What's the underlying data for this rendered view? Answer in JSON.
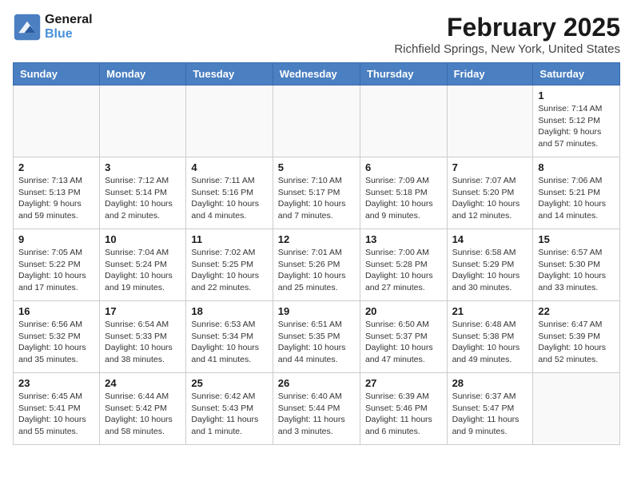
{
  "logo": {
    "line1": "General",
    "line2": "Blue"
  },
  "title": "February 2025",
  "location": "Richfield Springs, New York, United States",
  "days_of_week": [
    "Sunday",
    "Monday",
    "Tuesday",
    "Wednesday",
    "Thursday",
    "Friday",
    "Saturday"
  ],
  "weeks": [
    [
      {
        "day": "",
        "info": ""
      },
      {
        "day": "",
        "info": ""
      },
      {
        "day": "",
        "info": ""
      },
      {
        "day": "",
        "info": ""
      },
      {
        "day": "",
        "info": ""
      },
      {
        "day": "",
        "info": ""
      },
      {
        "day": "1",
        "info": "Sunrise: 7:14 AM\nSunset: 5:12 PM\nDaylight: 9 hours and 57 minutes."
      }
    ],
    [
      {
        "day": "2",
        "info": "Sunrise: 7:13 AM\nSunset: 5:13 PM\nDaylight: 9 hours and 59 minutes."
      },
      {
        "day": "3",
        "info": "Sunrise: 7:12 AM\nSunset: 5:14 PM\nDaylight: 10 hours and 2 minutes."
      },
      {
        "day": "4",
        "info": "Sunrise: 7:11 AM\nSunset: 5:16 PM\nDaylight: 10 hours and 4 minutes."
      },
      {
        "day": "5",
        "info": "Sunrise: 7:10 AM\nSunset: 5:17 PM\nDaylight: 10 hours and 7 minutes."
      },
      {
        "day": "6",
        "info": "Sunrise: 7:09 AM\nSunset: 5:18 PM\nDaylight: 10 hours and 9 minutes."
      },
      {
        "day": "7",
        "info": "Sunrise: 7:07 AM\nSunset: 5:20 PM\nDaylight: 10 hours and 12 minutes."
      },
      {
        "day": "8",
        "info": "Sunrise: 7:06 AM\nSunset: 5:21 PM\nDaylight: 10 hours and 14 minutes."
      }
    ],
    [
      {
        "day": "9",
        "info": "Sunrise: 7:05 AM\nSunset: 5:22 PM\nDaylight: 10 hours and 17 minutes."
      },
      {
        "day": "10",
        "info": "Sunrise: 7:04 AM\nSunset: 5:24 PM\nDaylight: 10 hours and 19 minutes."
      },
      {
        "day": "11",
        "info": "Sunrise: 7:02 AM\nSunset: 5:25 PM\nDaylight: 10 hours and 22 minutes."
      },
      {
        "day": "12",
        "info": "Sunrise: 7:01 AM\nSunset: 5:26 PM\nDaylight: 10 hours and 25 minutes."
      },
      {
        "day": "13",
        "info": "Sunrise: 7:00 AM\nSunset: 5:28 PM\nDaylight: 10 hours and 27 minutes."
      },
      {
        "day": "14",
        "info": "Sunrise: 6:58 AM\nSunset: 5:29 PM\nDaylight: 10 hours and 30 minutes."
      },
      {
        "day": "15",
        "info": "Sunrise: 6:57 AM\nSunset: 5:30 PM\nDaylight: 10 hours and 33 minutes."
      }
    ],
    [
      {
        "day": "16",
        "info": "Sunrise: 6:56 AM\nSunset: 5:32 PM\nDaylight: 10 hours and 35 minutes."
      },
      {
        "day": "17",
        "info": "Sunrise: 6:54 AM\nSunset: 5:33 PM\nDaylight: 10 hours and 38 minutes."
      },
      {
        "day": "18",
        "info": "Sunrise: 6:53 AM\nSunset: 5:34 PM\nDaylight: 10 hours and 41 minutes."
      },
      {
        "day": "19",
        "info": "Sunrise: 6:51 AM\nSunset: 5:35 PM\nDaylight: 10 hours and 44 minutes."
      },
      {
        "day": "20",
        "info": "Sunrise: 6:50 AM\nSunset: 5:37 PM\nDaylight: 10 hours and 47 minutes."
      },
      {
        "day": "21",
        "info": "Sunrise: 6:48 AM\nSunset: 5:38 PM\nDaylight: 10 hours and 49 minutes."
      },
      {
        "day": "22",
        "info": "Sunrise: 6:47 AM\nSunset: 5:39 PM\nDaylight: 10 hours and 52 minutes."
      }
    ],
    [
      {
        "day": "23",
        "info": "Sunrise: 6:45 AM\nSunset: 5:41 PM\nDaylight: 10 hours and 55 minutes."
      },
      {
        "day": "24",
        "info": "Sunrise: 6:44 AM\nSunset: 5:42 PM\nDaylight: 10 hours and 58 minutes."
      },
      {
        "day": "25",
        "info": "Sunrise: 6:42 AM\nSunset: 5:43 PM\nDaylight: 11 hours and 1 minute."
      },
      {
        "day": "26",
        "info": "Sunrise: 6:40 AM\nSunset: 5:44 PM\nDaylight: 11 hours and 3 minutes."
      },
      {
        "day": "27",
        "info": "Sunrise: 6:39 AM\nSunset: 5:46 PM\nDaylight: 11 hours and 6 minutes."
      },
      {
        "day": "28",
        "info": "Sunrise: 6:37 AM\nSunset: 5:47 PM\nDaylight: 11 hours and 9 minutes."
      },
      {
        "day": "",
        "info": ""
      }
    ]
  ]
}
